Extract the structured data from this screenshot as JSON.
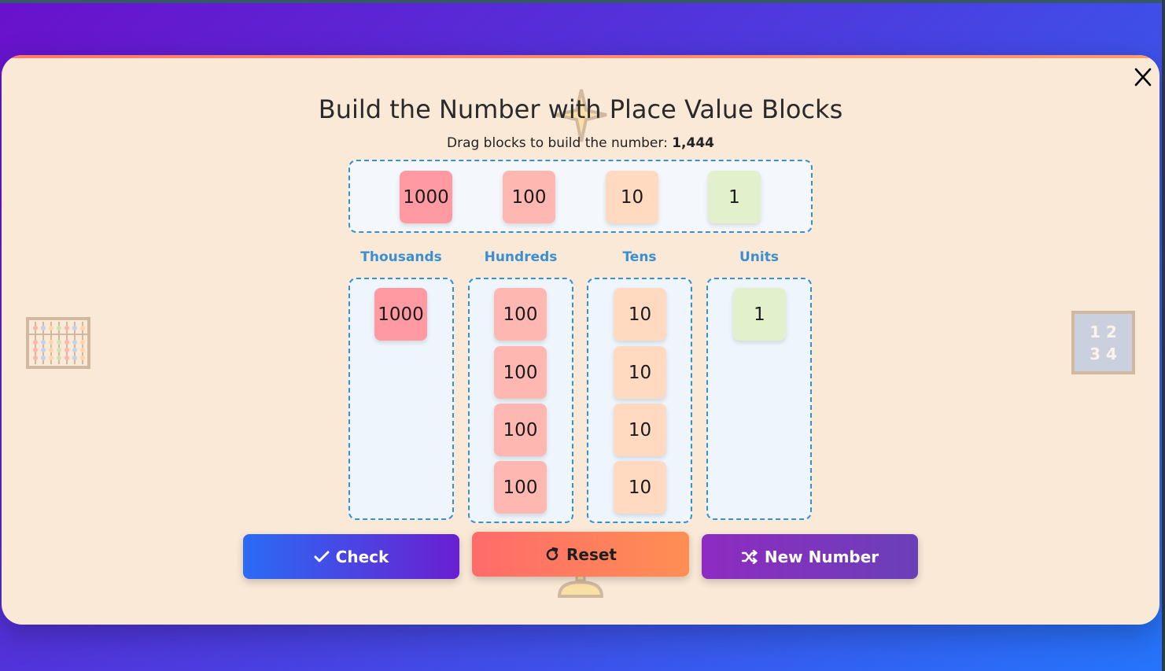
{
  "modal": {
    "title": "Build the Number with Place Value Blocks",
    "instruction_prefix": "Drag blocks to build the number:",
    "target_number": "1,444",
    "close_label": "X"
  },
  "palette": {
    "blocks": [
      "1000",
      "100",
      "10",
      "1"
    ]
  },
  "columns": {
    "thousands": {
      "label": "Thousands",
      "blocks": [
        "1000"
      ]
    },
    "hundreds": {
      "label": "Hundreds",
      "blocks": [
        "100",
        "100",
        "100",
        "100"
      ]
    },
    "tens": {
      "label": "Tens",
      "blocks": [
        "10",
        "10",
        "10",
        "10"
      ]
    },
    "units": {
      "label": "Units",
      "blocks": [
        "1"
      ]
    }
  },
  "buttons": {
    "check": "Check",
    "reset": "Reset",
    "new_number": "New Number"
  },
  "decor": {
    "number_card": [
      "1 2",
      "3 4"
    ],
    "icons": [
      "abacus-icon",
      "number-card-icon",
      "trophy-icon"
    ]
  },
  "colors": {
    "thousands": "#ff9aa2",
    "hundreds": "#ffb7b2",
    "tens": "#ffdac1",
    "units": "#e2f0cb",
    "accent": "#3b8fd0"
  }
}
